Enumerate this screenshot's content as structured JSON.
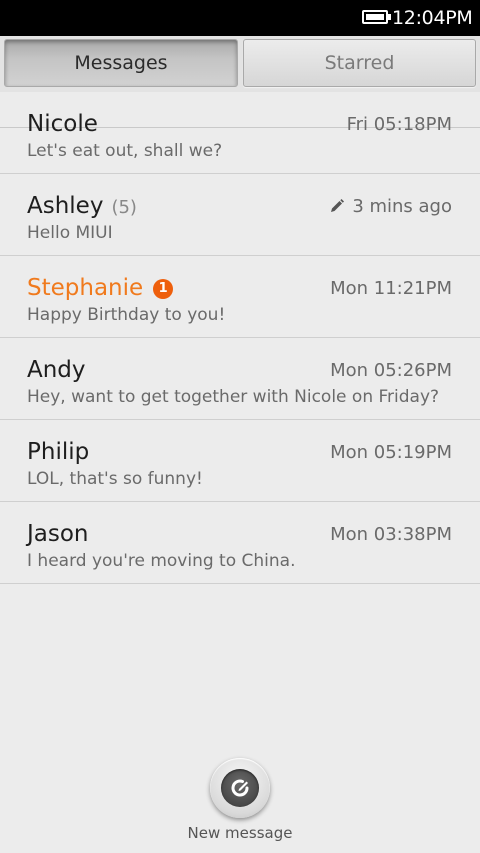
{
  "status_bar": {
    "time": "12:04PM",
    "battery_icon": "battery-full-icon"
  },
  "tabs": [
    {
      "label": "Messages",
      "selected": true
    },
    {
      "label": "Starred",
      "selected": false
    }
  ],
  "conversations": [
    {
      "name": "Nicole",
      "count": "",
      "badge": "",
      "time": "Fri 05:18PM",
      "draft": false,
      "preview": "Let's eat out, shall we?",
      "unread": false
    },
    {
      "name": "Ashley",
      "count": "(5)",
      "badge": "",
      "time": "3 mins ago",
      "draft": true,
      "preview": "Hello MIUI",
      "unread": false
    },
    {
      "name": "Stephanie",
      "count": "",
      "badge": "1",
      "time": "Mon 11:21PM",
      "draft": false,
      "preview": "Happy Birthday to you!",
      "unread": true
    },
    {
      "name": "Andy",
      "count": "",
      "badge": "",
      "time": "Mon 05:26PM",
      "draft": false,
      "preview": "Hey, want to get together with Nicole on Friday?",
      "unread": false
    },
    {
      "name": "Philip",
      "count": "",
      "badge": "",
      "time": "Mon 05:19PM",
      "draft": false,
      "preview": "LOL, that's so funny!",
      "unread": false
    },
    {
      "name": "Jason",
      "count": "",
      "badge": "",
      "time": "Mon 03:38PM",
      "draft": false,
      "preview": "I heard you're moving to China.",
      "unread": false
    }
  ],
  "new_message": {
    "label": "New message",
    "icon": "compose-icon"
  },
  "colors": {
    "unread_name": "#f07a1d",
    "badge": "#ee5f0c",
    "background": "#ececec"
  }
}
